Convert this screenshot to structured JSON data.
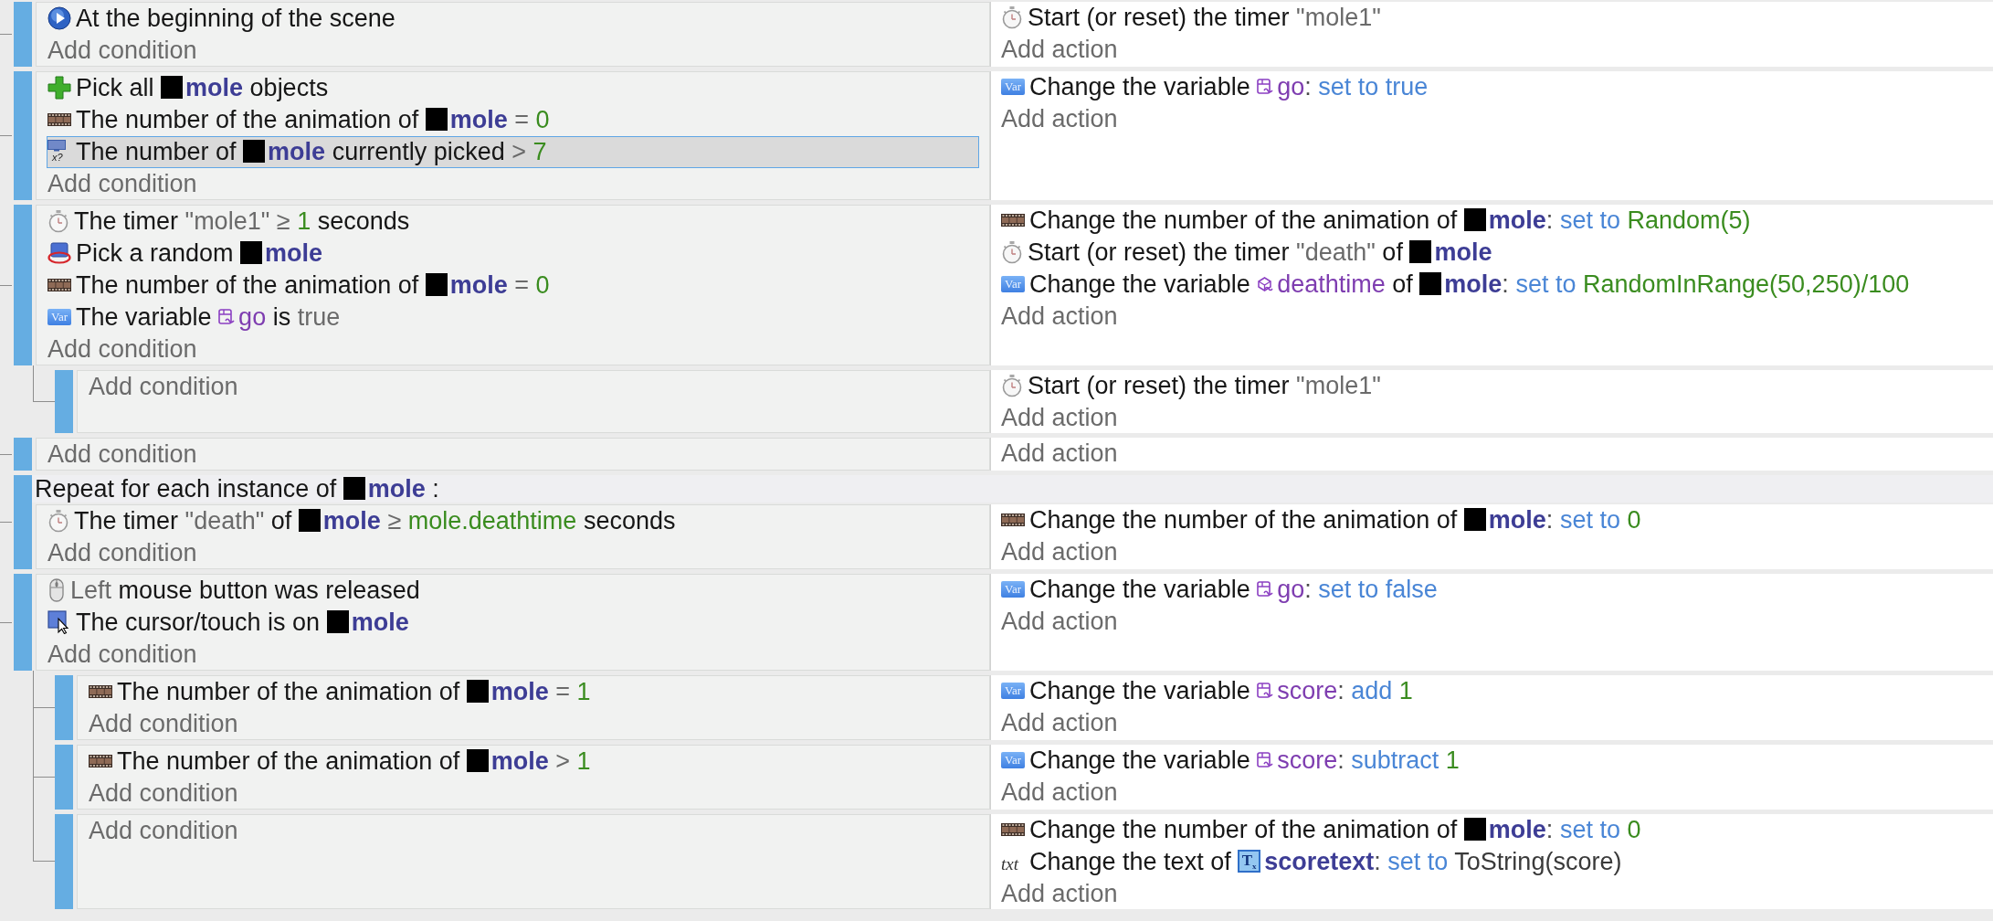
{
  "events": [
    {
      "kind": "standard",
      "conditions": [
        {
          "kind": "play",
          "selected": false,
          "parts": [
            {
              "kind": "text",
              "text": "At the beginning of the scene"
            }
          ]
        }
      ],
      "add_condition": "Add condition",
      "actions": [
        {
          "kind": "timer",
          "selected": false,
          "parts": [
            {
              "kind": "text",
              "text": "Start (or reset) the timer"
            },
            {
              "kind": "value",
              "text": "\"mole1\""
            }
          ]
        }
      ],
      "add_action": "Add action"
    },
    {
      "kind": "standard",
      "conditions": [
        {
          "kind": "plus",
          "selected": false,
          "parts": [
            {
              "kind": "text",
              "text": "Pick all"
            },
            {
              "kind": "object",
              "text": "mole"
            },
            {
              "kind": "text",
              "text": "objects"
            }
          ]
        },
        {
          "kind": "film",
          "selected": false,
          "parts": [
            {
              "kind": "text",
              "text": "The number of the animation of"
            },
            {
              "kind": "object",
              "text": "mole"
            },
            {
              "kind": "op",
              "text": "="
            },
            {
              "kind": "number",
              "text": "0"
            }
          ]
        },
        {
          "kind": "count",
          "icon_text": "x?",
          "selected": true,
          "parts": [
            {
              "kind": "text",
              "text": "The number of"
            },
            {
              "kind": "object",
              "text": "mole"
            },
            {
              "kind": "text",
              "text": "currently picked"
            },
            {
              "kind": "op",
              "text": ">"
            },
            {
              "kind": "number",
              "text": "7"
            }
          ]
        }
      ],
      "add_condition": "Add condition",
      "actions": [
        {
          "kind": "variable",
          "icon_text": "Var",
          "selected": false,
          "parts": [
            {
              "kind": "text",
              "text": "Change the variable"
            },
            {
              "kind": "variable",
              "text": "go"
            },
            {
              "kind": "punct",
              "text": ":"
            },
            {
              "kind": "keyword",
              "text": "set to true"
            }
          ]
        }
      ],
      "add_action": "Add action"
    },
    {
      "kind": "standard",
      "conditions": [
        {
          "kind": "timer",
          "selected": false,
          "parts": [
            {
              "kind": "text",
              "text": "The timer"
            },
            {
              "kind": "value",
              "text": "\"mole1\""
            },
            {
              "kind": "op",
              "text": "≥"
            },
            {
              "kind": "number",
              "text": "1"
            },
            {
              "kind": "text",
              "text": "seconds"
            }
          ]
        },
        {
          "kind": "random",
          "selected": false,
          "parts": [
            {
              "kind": "text",
              "text": "Pick a random"
            },
            {
              "kind": "object",
              "text": "mole"
            }
          ]
        },
        {
          "kind": "film",
          "selected": false,
          "parts": [
            {
              "kind": "text",
              "text": "The number of the animation of"
            },
            {
              "kind": "object",
              "text": "mole"
            },
            {
              "kind": "op",
              "text": "="
            },
            {
              "kind": "number",
              "text": "0"
            }
          ]
        },
        {
          "kind": "variable",
          "icon_text": "Var",
          "selected": false,
          "parts": [
            {
              "kind": "text",
              "text": "The variable"
            },
            {
              "kind": "variable",
              "text": "go"
            },
            {
              "kind": "text",
              "text": "is"
            },
            {
              "kind": "value",
              "text": "true"
            }
          ]
        }
      ],
      "add_condition": "Add condition",
      "actions": [
        {
          "kind": "film",
          "selected": false,
          "parts": [
            {
              "kind": "text",
              "text": "Change the number of the animation of"
            },
            {
              "kind": "object",
              "text": "mole"
            },
            {
              "kind": "punct",
              "text": ":"
            },
            {
              "kind": "keyword",
              "text": "set to"
            },
            {
              "kind": "number",
              "text": "Random(5)"
            }
          ]
        },
        {
          "kind": "timer",
          "selected": false,
          "parts": [
            {
              "kind": "text",
              "text": "Start (or reset) the timer"
            },
            {
              "kind": "value",
              "text": "\"death\""
            },
            {
              "kind": "text",
              "text": "of"
            },
            {
              "kind": "object",
              "text": "mole"
            }
          ]
        },
        {
          "kind": "variable",
          "icon_text": "Var",
          "selected": false,
          "parts": [
            {
              "kind": "text",
              "text": "Change the variable"
            },
            {
              "kind": "objectvariable",
              "text": "deathtime"
            },
            {
              "kind": "text",
              "text": "of"
            },
            {
              "kind": "object",
              "text": "mole"
            },
            {
              "kind": "punct",
              "text": ":"
            },
            {
              "kind": "keyword",
              "text": "set to"
            },
            {
              "kind": "number",
              "text": "RandomInRange(50,250)/100"
            }
          ]
        }
      ],
      "add_action": "Add action",
      "children": [
        {
          "kind": "standard",
          "add_condition": "Add condition",
          "actions": [
            {
              "kind": "timer",
              "selected": false,
              "parts": [
                {
                  "kind": "text",
                  "text": "Start (or reset) the timer"
                },
                {
                  "kind": "value",
                  "text": "\"mole1\""
                }
              ]
            }
          ],
          "add_action": "Add action"
        }
      ]
    },
    {
      "kind": "standard",
      "add_condition": "Add condition",
      "add_action": "Add action"
    },
    {
      "kind": "repeat",
      "header": [
        {
          "kind": "text",
          "text": "Repeat for each instance of"
        },
        {
          "kind": "object",
          "text": "mole"
        },
        {
          "kind": "text",
          "text": ":"
        }
      ],
      "conditions": [
        {
          "kind": "timer",
          "selected": false,
          "parts": [
            {
              "kind": "text",
              "text": "The timer"
            },
            {
              "kind": "value",
              "text": "\"death\""
            },
            {
              "kind": "text",
              "text": "of"
            },
            {
              "kind": "object",
              "text": "mole"
            },
            {
              "kind": "op",
              "text": "≥"
            },
            {
              "kind": "number",
              "text": "mole.deathtime"
            },
            {
              "kind": "text",
              "text": "seconds"
            }
          ]
        }
      ],
      "add_condition": "Add condition",
      "actions": [
        {
          "kind": "film",
          "selected": false,
          "parts": [
            {
              "kind": "text",
              "text": "Change the number of the animation of"
            },
            {
              "kind": "object",
              "text": "mole"
            },
            {
              "kind": "punct",
              "text": ":"
            },
            {
              "kind": "keyword",
              "text": "set to"
            },
            {
              "kind": "number",
              "text": "0"
            }
          ]
        }
      ],
      "add_action": "Add action"
    },
    {
      "kind": "standard",
      "conditions": [
        {
          "kind": "mouse",
          "selected": false,
          "parts": [
            {
              "kind": "value",
              "text": "Left"
            },
            {
              "kind": "text",
              "text": "mouse button was released"
            }
          ]
        },
        {
          "kind": "cursor",
          "selected": false,
          "parts": [
            {
              "kind": "text",
              "text": "The cursor/touch is on"
            },
            {
              "kind": "object",
              "text": "mole"
            }
          ]
        }
      ],
      "add_condition": "Add condition",
      "actions": [
        {
          "kind": "variable",
          "icon_text": "Var",
          "selected": false,
          "parts": [
            {
              "kind": "text",
              "text": "Change the variable"
            },
            {
              "kind": "variable",
              "text": "go"
            },
            {
              "kind": "punct",
              "text": ":"
            },
            {
              "kind": "keyword",
              "text": "set to false"
            }
          ]
        }
      ],
      "add_action": "Add action",
      "children": [
        {
          "kind": "standard",
          "conditions": [
            {
              "kind": "film",
              "selected": false,
              "parts": [
                {
                  "kind": "text",
                  "text": "The number of the animation of"
                },
                {
                  "kind": "object",
                  "text": "mole"
                },
                {
                  "kind": "op",
                  "text": "="
                },
                {
                  "kind": "number",
                  "text": "1"
                }
              ]
            }
          ],
          "add_condition": "Add condition",
          "actions": [
            {
              "kind": "variable",
              "icon_text": "Var",
              "selected": false,
              "parts": [
                {
                  "kind": "text",
                  "text": "Change the variable"
                },
                {
                  "kind": "variable",
                  "text": "score"
                },
                {
                  "kind": "punct",
                  "text": ":"
                },
                {
                  "kind": "keyword",
                  "text": "add"
                },
                {
                  "kind": "number",
                  "text": "1"
                }
              ]
            }
          ],
          "add_action": "Add action"
        },
        {
          "kind": "standard",
          "conditions": [
            {
              "kind": "film",
              "selected": false,
              "parts": [
                {
                  "kind": "text",
                  "text": "The number of the animation of"
                },
                {
                  "kind": "object",
                  "text": "mole"
                },
                {
                  "kind": "op",
                  "text": ">"
                },
                {
                  "kind": "number",
                  "text": "1"
                }
              ]
            }
          ],
          "add_condition": "Add condition",
          "actions": [
            {
              "kind": "variable",
              "icon_text": "Var",
              "selected": false,
              "parts": [
                {
                  "kind": "text",
                  "text": "Change the variable"
                },
                {
                  "kind": "variable",
                  "text": "score"
                },
                {
                  "kind": "punct",
                  "text": ":"
                },
                {
                  "kind": "keyword",
                  "text": "subtract"
                },
                {
                  "kind": "number",
                  "text": "1"
                }
              ]
            }
          ],
          "add_action": "Add action"
        },
        {
          "kind": "standard",
          "add_condition": "Add condition",
          "actions": [
            {
              "kind": "film",
              "selected": false,
              "parts": [
                {
                  "kind": "text",
                  "text": "Change the number of the animation of"
                },
                {
                  "kind": "object",
                  "text": "mole"
                },
                {
                  "kind": "punct",
                  "text": ":"
                },
                {
                  "kind": "keyword",
                  "text": "set to"
                },
                {
                  "kind": "number",
                  "text": "0"
                }
              ]
            },
            {
              "kind": "text",
              "icon_text": "txt",
              "selected": false,
              "parts": [
                {
                  "kind": "text",
                  "text": "Change the text of"
                },
                {
                  "kind": "textobject",
                  "thumb_text": "T$_{x}$",
                  "text": "scoretext"
                },
                {
                  "kind": "punct",
                  "text": ":"
                },
                {
                  "kind": "keyword",
                  "text": "set to"
                },
                {
                  "kind": "expression",
                  "text": "ToString(score)"
                }
              ]
            }
          ],
          "add_action": "Add action"
        }
      ]
    }
  ]
}
